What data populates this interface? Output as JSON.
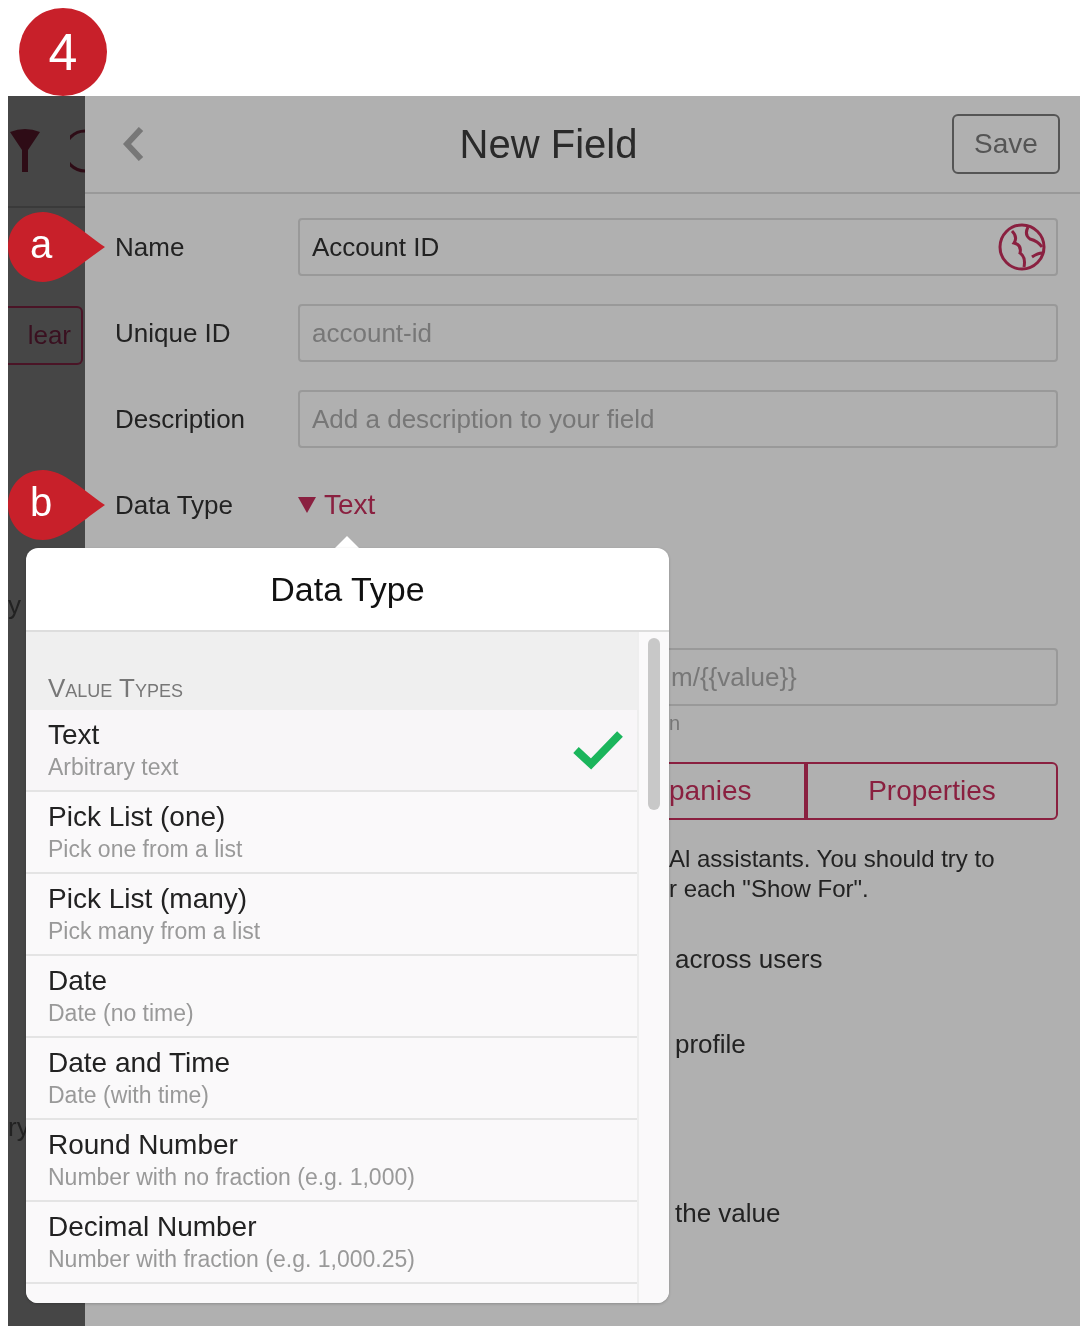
{
  "step_badge": "4",
  "sidebar": {
    "clear_button": "lear",
    "fragments": [
      "y",
      "ry"
    ]
  },
  "header": {
    "title": "New Field",
    "save": "Save"
  },
  "form": [
    {
      "label": "Name",
      "marker": "a",
      "value": "Account ID",
      "globe": true
    },
    {
      "label": "Unique ID",
      "placeholder": "account-id"
    },
    {
      "label": "Description",
      "placeholder": "Add a description to your field"
    }
  ],
  "data_type": {
    "label": "Data Type",
    "marker": "b",
    "value": "Text"
  },
  "background": {
    "url_placeholder": "m/{{value}}",
    "hint": "n",
    "segments": [
      "panies",
      "Properties"
    ],
    "paragraph": [
      "Al assistants. You should try to",
      "r each \"Show For\"."
    ],
    "lines": [
      "across users",
      "profile",
      "the value"
    ]
  },
  "popover": {
    "title": "Data Type",
    "section": "Value Types",
    "items": [
      {
        "title": "Text",
        "subtitle": "Arbitrary text",
        "selected": true
      },
      {
        "title": "Pick List (one)",
        "subtitle": "Pick one from a list",
        "selected": false
      },
      {
        "title": "Pick List (many)",
        "subtitle": "Pick many from a list",
        "selected": false
      },
      {
        "title": "Date",
        "subtitle": "Date (no time)",
        "selected": false
      },
      {
        "title": "Date and Time",
        "subtitle": "Date (with time)",
        "selected": false
      },
      {
        "title": "Round Number",
        "subtitle": "Number with no fraction (e.g. 1,000)",
        "selected": false
      },
      {
        "title": "Decimal Number",
        "subtitle": "Number with fraction (e.g. 1,000.25)",
        "selected": false
      }
    ]
  }
}
